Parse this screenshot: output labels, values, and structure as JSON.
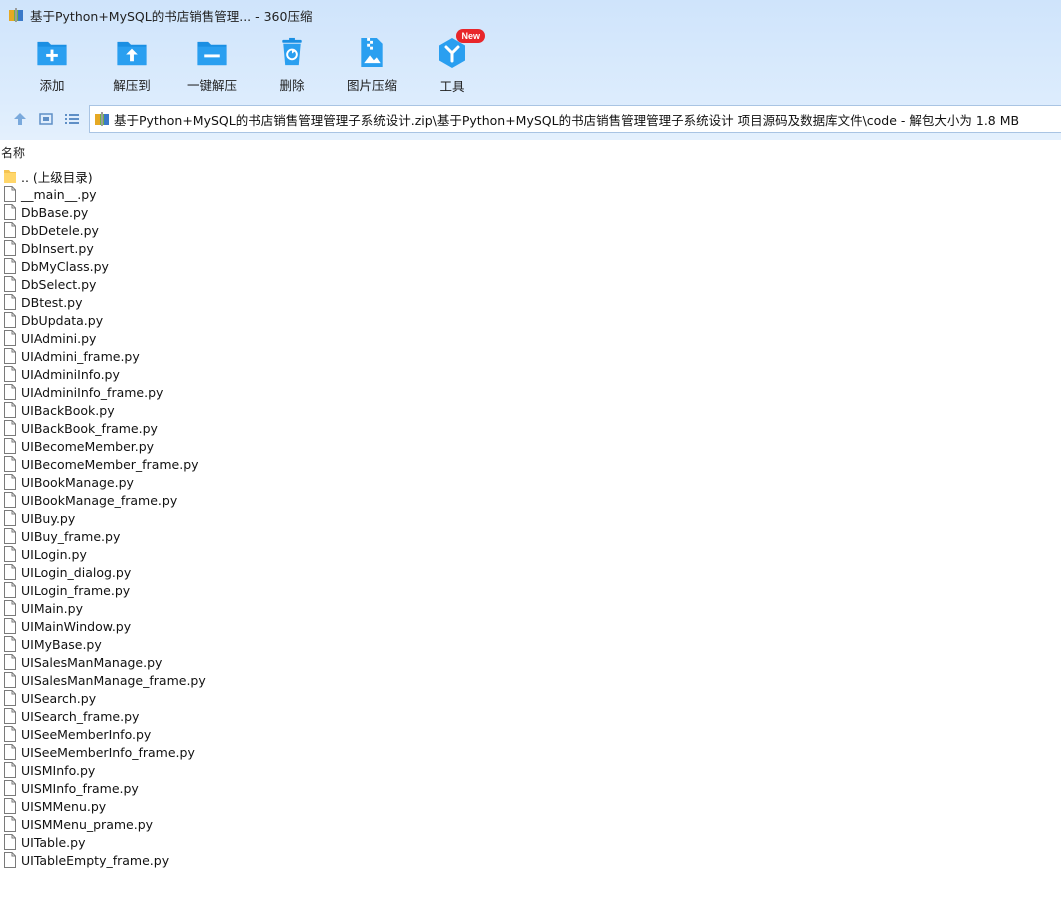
{
  "window": {
    "title": "基于Python+MySQL的书店销售管理... - 360压缩"
  },
  "toolbar": {
    "items": [
      {
        "label": "添加",
        "icon": "add-icon"
      },
      {
        "label": "解压到",
        "icon": "extract-to-icon"
      },
      {
        "label": "一键解压",
        "icon": "one-click-extract-icon"
      },
      {
        "label": "删除",
        "icon": "delete-icon"
      },
      {
        "label": "图片压缩",
        "icon": "image-compress-icon"
      },
      {
        "label": "工具",
        "icon": "tools-icon",
        "badge": "New"
      }
    ]
  },
  "path": {
    "text": "基于Python+MySQL的书店销售管理管理子系统设计.zip\\基于Python+MySQL的书店销售管理管理子系统设计 项目源码及数据库文件\\code - 解包大小为 1.8 MB"
  },
  "list": {
    "column_name": "名称",
    "parent_label": ".. (上级目录)",
    "files": [
      "__main__.py",
      "DbBase.py",
      "DbDetele.py",
      "DbInsert.py",
      "DbMyClass.py",
      "DbSelect.py",
      "DBtest.py",
      "DbUpdata.py",
      "UIAdmini.py",
      "UIAdmini_frame.py",
      "UIAdminiInfo.py",
      "UIAdminiInfo_frame.py",
      "UIBackBook.py",
      "UIBackBook_frame.py",
      "UIBecomeMember.py",
      "UIBecomeMember_frame.py",
      "UIBookManage.py",
      "UIBookManage_frame.py",
      "UIBuy.py",
      "UIBuy_frame.py",
      "UILogin.py",
      "UILogin_dialog.py",
      "UILogin_frame.py",
      "UIMain.py",
      "UIMainWindow.py",
      "UIMyBase.py",
      "UISalesManManage.py",
      "UISalesManManage_frame.py",
      "UISearch.py",
      "UISearch_frame.py",
      "UISeeMemberInfo.py",
      "UISeeMemberInfo_frame.py",
      "UISMInfo.py",
      "UISMInfo_frame.py",
      "UISMMenu.py",
      "UISMMenu_prame.py",
      "UITable.py",
      "UITableEmpty_frame.py"
    ]
  },
  "colors": {
    "toolbar_bg": "#d6e8fc",
    "icon_blue": "#1a8fe3",
    "badge_red": "#e8262b"
  }
}
